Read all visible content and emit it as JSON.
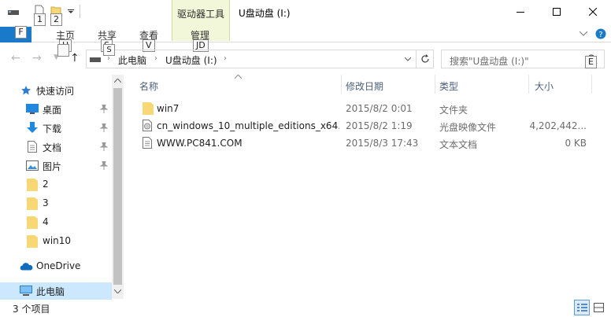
{
  "window": {
    "title": "U盘动盘 (I:)",
    "tools_tab": "驱动器工具"
  },
  "quick_access_toolbar": {
    "keytips": [
      "1",
      "2"
    ]
  },
  "ribbon": {
    "file_keytip": "F",
    "tabs": [
      {
        "label": "主页",
        "keytip": "H"
      },
      {
        "label": "共享",
        "keytip": "S"
      },
      {
        "label": "查看",
        "keytip": "V"
      },
      {
        "label": "管理",
        "keytip": "JD"
      }
    ]
  },
  "address": {
    "segments": [
      "此电脑",
      "U盘动盘 (I:)"
    ]
  },
  "search": {
    "placeholder": "搜索\"U盘动盘 (I:)\"",
    "keytip": "E"
  },
  "nav_pane": {
    "items": [
      {
        "label": "快速访问",
        "icon": "star-icon"
      },
      {
        "label": "桌面",
        "icon": "desktop-icon",
        "pinned": true
      },
      {
        "label": "下载",
        "icon": "download-icon",
        "pinned": true
      },
      {
        "label": "文档",
        "icon": "document-icon",
        "pinned": true
      },
      {
        "label": "图片",
        "icon": "picture-icon",
        "pinned": true
      },
      {
        "label": "2",
        "icon": "folder-icon"
      },
      {
        "label": "3",
        "icon": "folder-icon"
      },
      {
        "label": "4",
        "icon": "folder-icon"
      },
      {
        "label": "win10",
        "icon": "folder-icon"
      },
      {
        "label": "OneDrive",
        "icon": "cloud-icon"
      },
      {
        "label": "此电脑",
        "icon": "computer-icon",
        "selected": true
      }
    ]
  },
  "columns": {
    "name": "名称",
    "date": "修改日期",
    "type": "类型",
    "size": "大小"
  },
  "files": [
    {
      "name": "win7",
      "date": "2015/8/2 0:01",
      "type": "文件夹",
      "size": "",
      "icon": "folder-icon"
    },
    {
      "name": "cn_windows_10_multiple_editions_x64...",
      "date": "2015/8/2 1:19",
      "type": "光盘映像文件",
      "size": "4,202,442...",
      "icon": "disc-image-icon"
    },
    {
      "name": "WWW.PC841.COM",
      "date": "2015/8/3 17:43",
      "type": "文本文档",
      "size": "0 KB",
      "icon": "text-file-icon"
    }
  ],
  "status": {
    "item_count": "3 个项目"
  },
  "colors": {
    "accent": "#1979ca",
    "selection": "#cce8ff",
    "tools_tab_bg": "#f1f7d8",
    "folder": "#f8d775"
  }
}
